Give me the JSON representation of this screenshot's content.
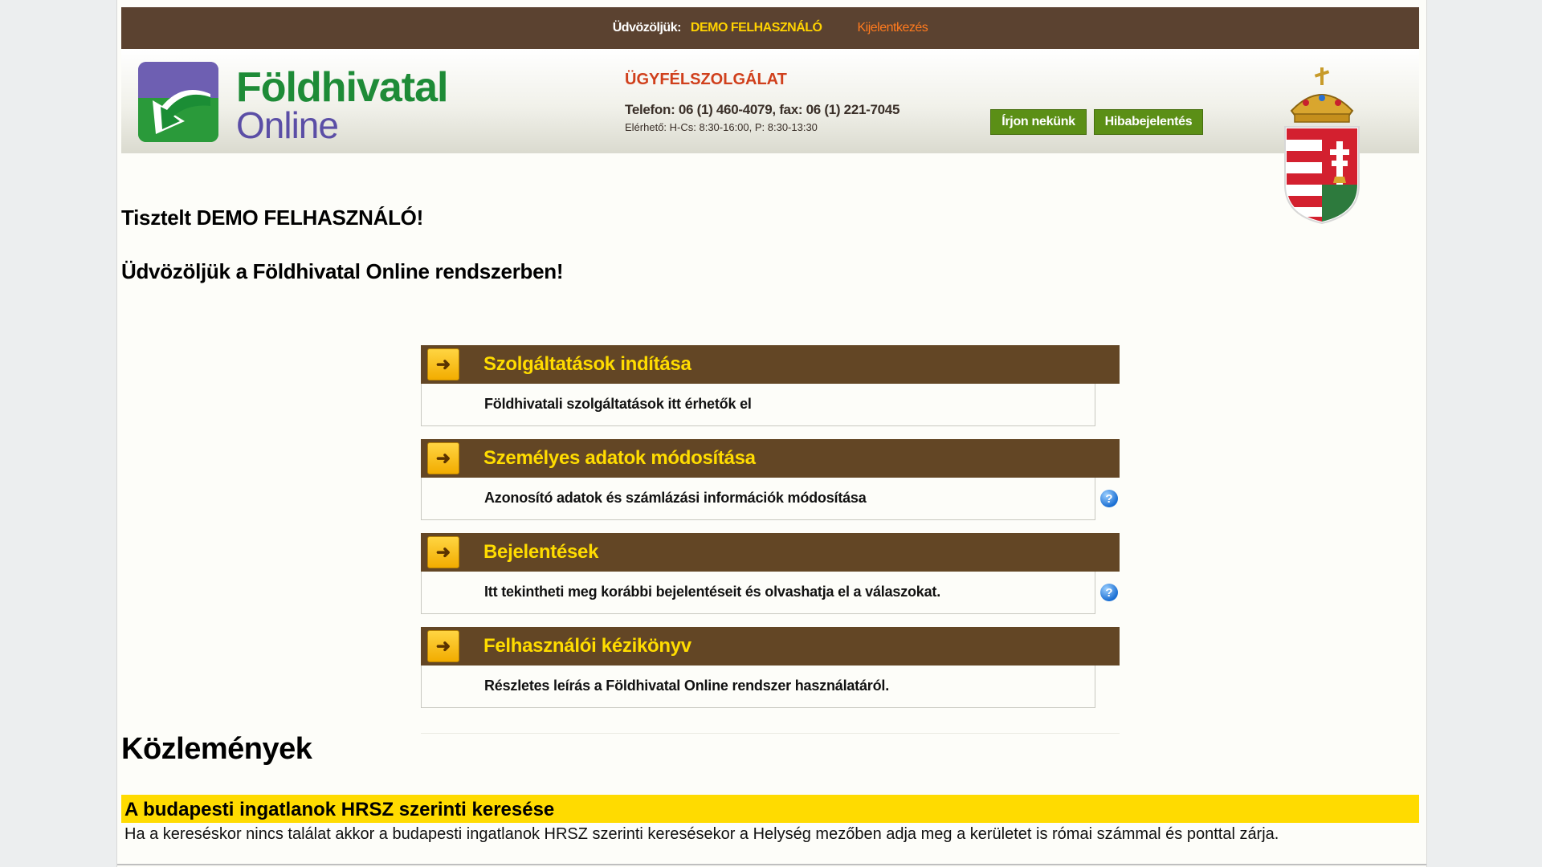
{
  "topbar": {
    "greeting": "Üdvözöljük:",
    "user_name": "DEMO FELHASZNÁLÓ",
    "logout": "Kijelentkezés"
  },
  "header": {
    "logo_line1": "Földhivatal",
    "logo_line2": "Online",
    "support_title": "ÜGYFÉLSZOLGÁLAT",
    "support_phone": "Telefon: 06 (1) 460-4079, fax: 06 (1) 221-7045",
    "support_hours": "Elérhető: H-Cs: 8:30-16:00, P: 8:30-13:30",
    "btn_write": "Írjon nekünk",
    "btn_bug": "Hibabejelentés"
  },
  "main": {
    "greeting1": "Tisztelt DEMO FELHASZNÁLÓ!",
    "greeting2": "Üdvözöljük a Földhivatal Online rendszerben!",
    "menu": [
      {
        "title": "Szolgáltatások indítása",
        "desc": "Földhivatali szolgáltatások itt érhetők el",
        "help": false
      },
      {
        "title": "Személyes adatok módosítása",
        "desc": "Azonosító adatok és számlázási információk módosítása",
        "help": true
      },
      {
        "title": "Bejelentések",
        "desc": "Itt tekintheti meg korábbi bejelentéseit és olvashatja el a válaszokat.",
        "help": true
      },
      {
        "title": "Felhasználói kézikönyv",
        "desc": "Részletes leírás a Földhivatal Online rendszer használatáról.",
        "help": false
      }
    ],
    "help_glyph": "?"
  },
  "notices": {
    "title": "Közlemények",
    "items": [
      {
        "title": "A budapesti ingatlanok HRSZ szerinti keresése",
        "text": "Ha a kereséskor nincs találat akkor a budapesti ingatlanok HRSZ szerinti keresésekor a Helység mezőben adja meg a kerületet is római számmal és ponttal zárja."
      }
    ]
  },
  "colors": {
    "topbar_bg": "#5b4230",
    "menu_header_bg": "#634625",
    "menu_title": "#ffdc00",
    "button_green": "#5b8f16",
    "notice_bar": "#ffdb00"
  },
  "icons": {
    "menu_arrow": "arrow-right-icon",
    "help": "help-question-icon",
    "logo": "foldhivatal-logo-icon",
    "coat_of_arms": "hungarian-coat-of-arms-icon"
  }
}
